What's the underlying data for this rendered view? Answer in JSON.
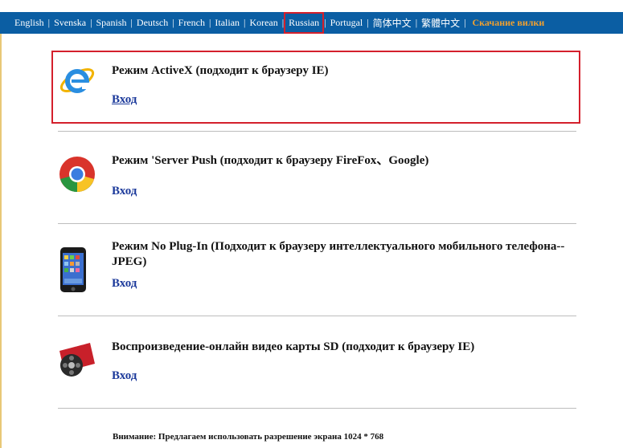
{
  "languages": [
    {
      "label": "English"
    },
    {
      "label": "Svenska"
    },
    {
      "label": "Spanish"
    },
    {
      "label": "Deutsch"
    },
    {
      "label": "French"
    },
    {
      "label": "Italian"
    },
    {
      "label": "Korean"
    },
    {
      "label": "Russian"
    },
    {
      "label": "Portugal"
    },
    {
      "label": "简体中文"
    },
    {
      "label": "繁體中文"
    }
  ],
  "download_label": "Скачание вилки",
  "modes": [
    {
      "title": "Режим ActiveX (подходит к браузеру IE)",
      "enter": "Вход",
      "icon": "internet-explorer-icon"
    },
    {
      "title": "Режим 'Server Push (подходит к браузеру FireFox、Google)",
      "enter": "Вход",
      "icon": "chrome-icon"
    },
    {
      "title": "Режим No Plug-In (Подходит к браузеру интеллектуального мобильного телефона--JPEG)",
      "enter": "Вход",
      "icon": "mobile-phone-icon"
    },
    {
      "title": "Воспроизведение-онлайн видео карты SD (подходит к браузеру IE)",
      "enter": "Вход",
      "icon": "film-reel-icon"
    }
  ],
  "notice": "Внимание: Предлагаем использовать разрешение экрана 1024 * 768",
  "colors": {
    "topbar": "#0b5ea3",
    "download": "#f0a030",
    "link": "#1c3a9b",
    "highlight": "#d4202c"
  }
}
